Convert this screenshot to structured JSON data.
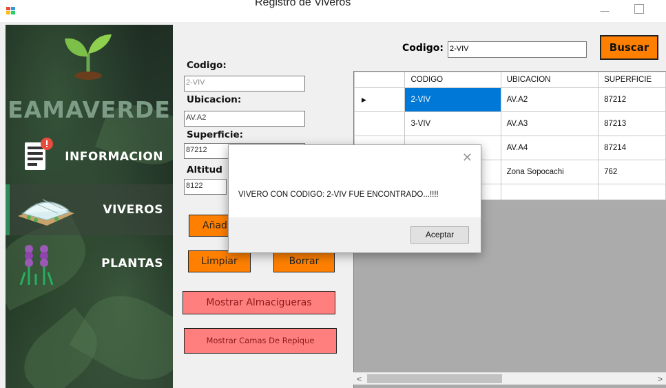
{
  "window": {
    "title": "Registro de Viveros"
  },
  "sidebar": {
    "brand": "EAMAVERDE",
    "items": [
      {
        "label": "INFORMACION",
        "icon": "document-info-icon"
      },
      {
        "label": "VIVEROS",
        "icon": "greenhouse-icon"
      },
      {
        "label": "PLANTAS",
        "icon": "lavender-plant-icon"
      }
    ]
  },
  "form": {
    "codigo_label": "Codigo:",
    "codigo_value": "2-VIV",
    "ubicacion_label": "Ubicacion:",
    "ubicacion_value": "AV.A2",
    "superficie_label": "Superficie:",
    "superficie_value": "87212",
    "altitud_label": "Altitud",
    "altitud_value": "8122",
    "add_label": "Añad",
    "clear_label": "Limpiar",
    "delete_label": "Borrar",
    "show_seedbeds_label": "Mostrar Almacigueras",
    "show_beds_label": "Mostrar Camas De Repique"
  },
  "search": {
    "label": "Codigo:",
    "value": "2-VIV",
    "button_label": "Buscar"
  },
  "grid": {
    "columns": [
      "CODIGO",
      "UBICACION",
      "SUPERFICIE"
    ],
    "rows": [
      {
        "codigo": "2-VIV",
        "ubicacion": "AV.A2",
        "superficie": "87212"
      },
      {
        "codigo": "3-VIV",
        "ubicacion": "AV.A3",
        "superficie": "87213"
      },
      {
        "codigo": "",
        "ubicacion": "AV.A4",
        "superficie": "87214"
      },
      {
        "codigo": "",
        "ubicacion": "Zona Sopocachi",
        "superficie": "762"
      }
    ]
  },
  "dialog": {
    "message": "VIVERO CON CODIGO: 2-VIV FUE ENCONTRADO...!!!!",
    "ok_label": "Aceptar"
  },
  "colors": {
    "accent_orange": "#ff8000",
    "pink_button": "#ff7f7f",
    "selection_blue": "#0078d7"
  }
}
